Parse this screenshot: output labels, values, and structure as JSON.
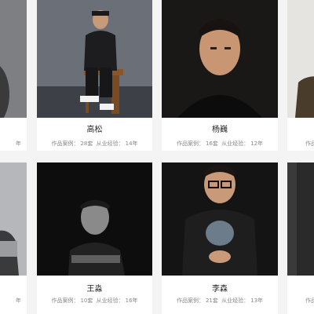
{
  "designers": [
    {
      "name": "",
      "meta": "年"
    },
    {
      "name": "高松",
      "cases_label": "作品案例：",
      "cases": "28套",
      "exp_label": "从业经验：",
      "exp": "14年"
    },
    {
      "name": "杨巍",
      "cases_label": "作品案例：",
      "cases": "16套",
      "exp_label": "从业经验：",
      "exp": "12年"
    },
    {
      "name": "",
      "meta": "作品"
    },
    {
      "name": "",
      "meta": "年"
    },
    {
      "name": "王淼",
      "cases_label": "作品案例：",
      "cases": "10套",
      "exp_label": "从业经验：",
      "exp": "16年"
    },
    {
      "name": "李森",
      "cases_label": "作品案例：",
      "cases": "21套",
      "exp_label": "从业经验：",
      "exp": "13年"
    },
    {
      "name": "",
      "meta": "作品"
    }
  ],
  "colors": {
    "card": "#ffffff",
    "page": "#f4f4f4",
    "name": "#222222",
    "meta": "#888888"
  }
}
